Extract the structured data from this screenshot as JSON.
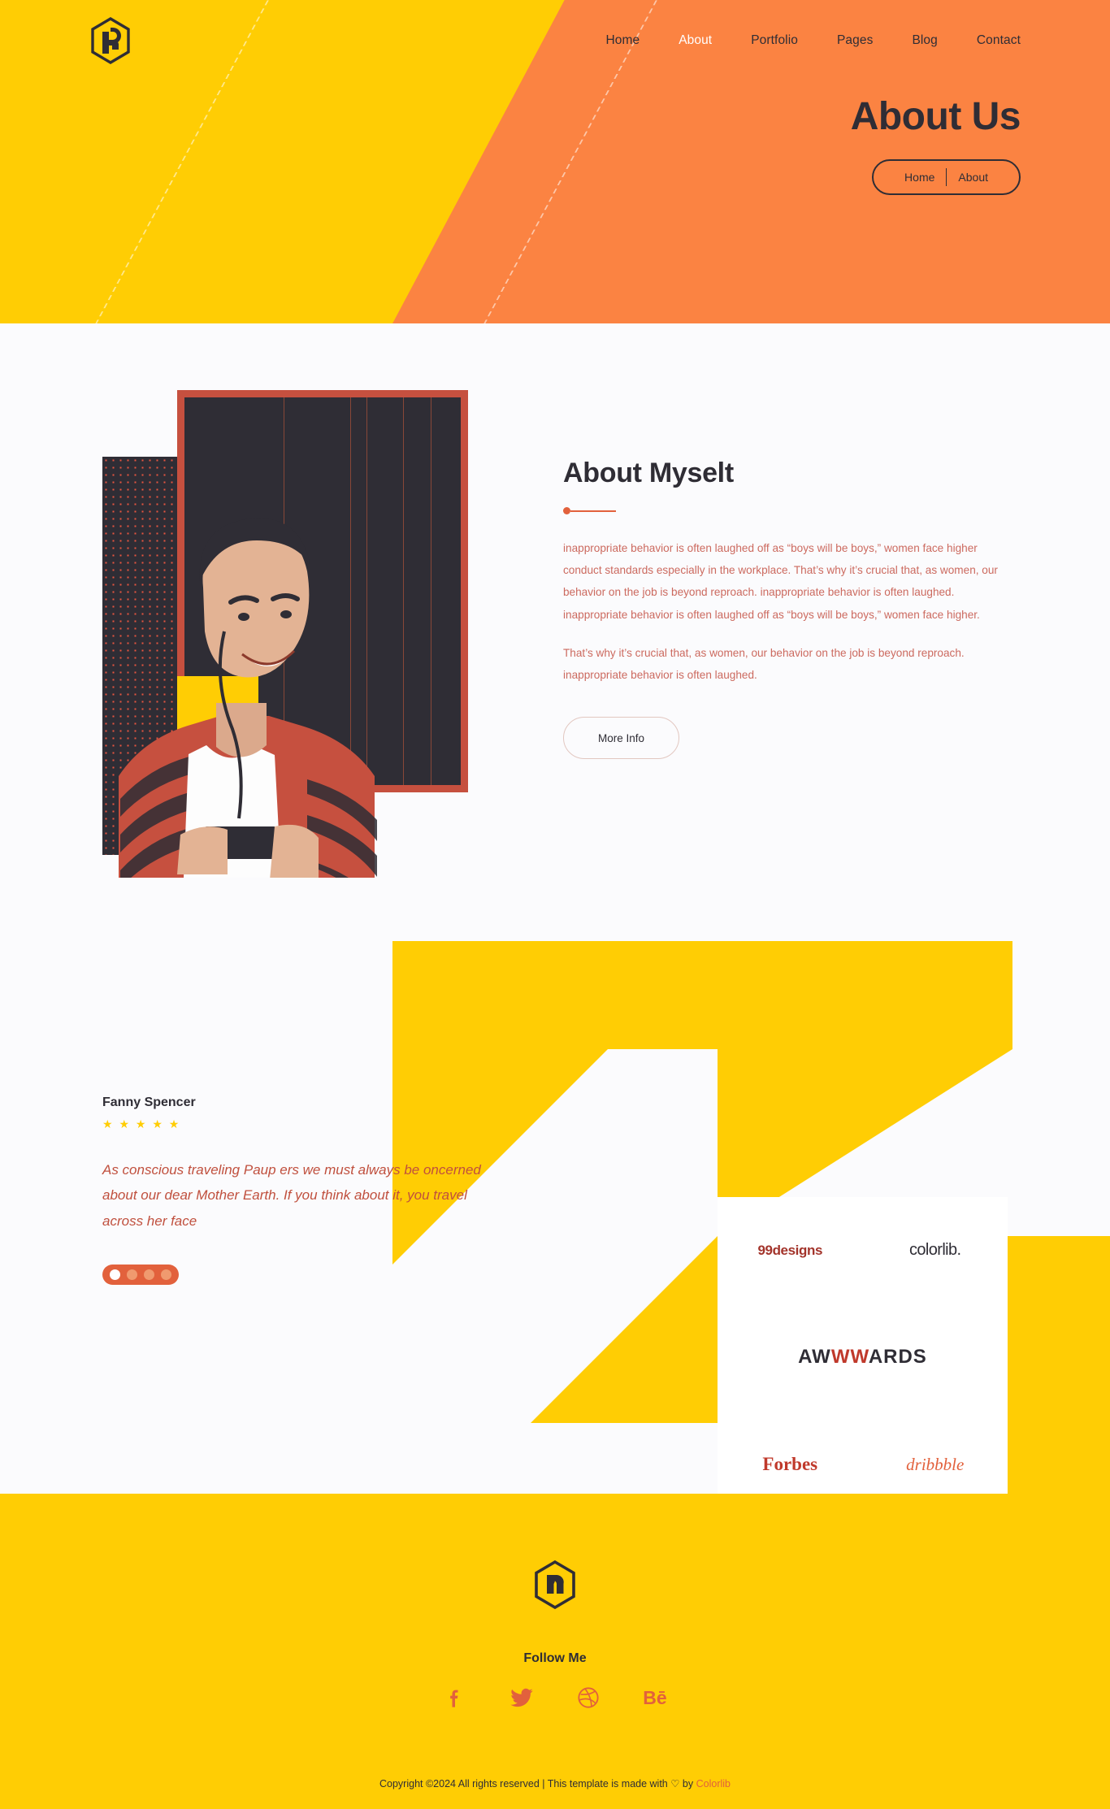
{
  "colors": {
    "orange": "#fb8342",
    "yellow": "#ffcd04",
    "dark": "#2f2d35",
    "accent_red": "#e2613c",
    "body_text": "#cc6a5f"
  },
  "header": {
    "logo_icon": "hexagon-h-logo-icon",
    "nav": [
      {
        "label": "Home",
        "active": false
      },
      {
        "label": "About",
        "active": true
      },
      {
        "label": "Portfolio",
        "active": false
      },
      {
        "label": "Pages",
        "active": false
      },
      {
        "label": "Blog",
        "active": false
      },
      {
        "label": "Contact",
        "active": false
      }
    ],
    "page_title": "About Us",
    "breadcrumb": {
      "home": "Home",
      "current": "About"
    }
  },
  "about": {
    "heading": "About Myselt",
    "paragraph_1": "inappropriate behavior is often laughed off as “boys will be boys,” women face higher conduct standards especially in the workplace. That’s why it’s crucial that, as women, our behavior on the job is beyond reproach. inappropriate behavior is often laughed. inappropriate behavior is often laughed off as “boys will be boys,” women face higher.",
    "paragraph_2": "That’s why it’s crucial that, as women, our behavior on the job is beyond reproach. inappropriate behavior is often laughed.",
    "button_label": "More Info",
    "image_alt": "portrait-photo"
  },
  "testimonial": {
    "name": "Fanny Spencer",
    "stars": "★ ★ ★ ★ ★",
    "rating": 5,
    "quote": "As conscious traveling Paup ers we must always be oncerned about our dear Mother Earth. If you think about it, you travel across her face",
    "slider_dots": 4,
    "active_dot": 0
  },
  "brands": [
    {
      "name": "99designs",
      "style": "99designs"
    },
    {
      "name": "colorlib.",
      "style": "colorlib"
    },
    {
      "name": "AWWWARDS",
      "style": "awwwards",
      "prefix": "AW",
      "mid": "WW",
      "suffix": "ARDS"
    },
    {
      "name": "Forbes",
      "style": "forbes"
    },
    {
      "name": "dribbble",
      "style": "dribbble"
    }
  ],
  "footer": {
    "logo_icon": "hexagon-h-logo-icon",
    "follow_title": "Follow Me",
    "socials": [
      {
        "name": "facebook-icon",
        "glyph": "f"
      },
      {
        "name": "twitter-icon",
        "glyph": "t"
      },
      {
        "name": "dribbble-icon",
        "glyph": "d"
      },
      {
        "name": "behance-icon",
        "glyph": "Bē"
      }
    ],
    "copyright_prefix": "Copyright ©2024 All rights reserved | This template is made with ",
    "copyright_heart": "♡",
    "copyright_mid": " by ",
    "copyright_link": "Colorlib"
  }
}
